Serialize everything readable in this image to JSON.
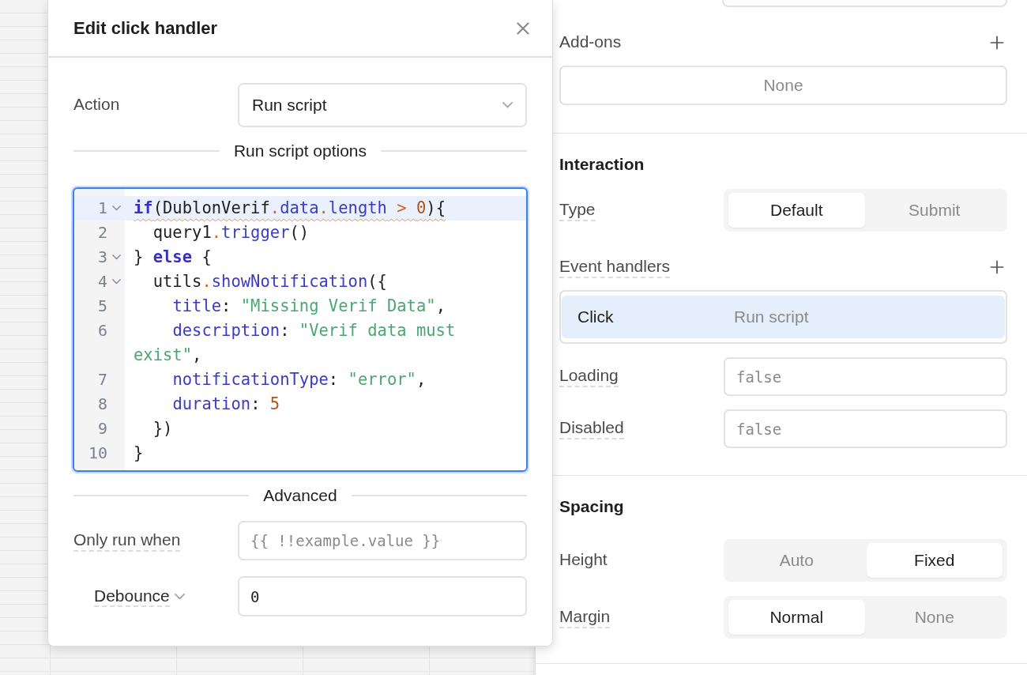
{
  "modal": {
    "title": "Edit click handler",
    "action": {
      "label": "Action",
      "value": "Run script"
    },
    "script_section": "Run script options",
    "code_lines": [
      {
        "number": "1",
        "foldable": true,
        "active": true,
        "warning": true,
        "tokens": [
          {
            "kind": "keyword",
            "text": "if"
          },
          {
            "kind": "plain",
            "text": "(DublonVerif"
          },
          {
            "kind": "operator",
            "text": "."
          },
          {
            "kind": "property",
            "text": "data"
          },
          {
            "kind": "operator",
            "text": "."
          },
          {
            "kind": "property",
            "text": "length"
          },
          {
            "kind": "operator",
            "text": " > "
          },
          {
            "kind": "number",
            "text": "0"
          },
          {
            "kind": "plain",
            "text": "){"
          }
        ]
      },
      {
        "number": "2",
        "foldable": false,
        "active": false,
        "warning": false,
        "tokens": [
          {
            "kind": "plain",
            "text": "  query1"
          },
          {
            "kind": "operator",
            "text": "."
          },
          {
            "kind": "property",
            "text": "trigger"
          },
          {
            "kind": "plain",
            "text": "()"
          }
        ]
      },
      {
        "number": "3",
        "foldable": true,
        "active": false,
        "warning": false,
        "tokens": [
          {
            "kind": "plain",
            "text": "} "
          },
          {
            "kind": "keyword",
            "text": "else"
          },
          {
            "kind": "plain",
            "text": " {"
          }
        ]
      },
      {
        "number": "4",
        "foldable": true,
        "active": false,
        "warning": false,
        "tokens": [
          {
            "kind": "plain",
            "text": "  utils"
          },
          {
            "kind": "operator",
            "text": "."
          },
          {
            "kind": "property",
            "text": "showNotification"
          },
          {
            "kind": "plain",
            "text": "({"
          }
        ]
      },
      {
        "number": "5",
        "foldable": false,
        "active": false,
        "warning": false,
        "tokens": [
          {
            "kind": "property",
            "text": "    title"
          },
          {
            "kind": "plain",
            "text": ": "
          },
          {
            "kind": "string",
            "text": "\"Missing Verif Data\""
          },
          {
            "kind": "plain",
            "text": ","
          }
        ]
      },
      {
        "number": "6",
        "foldable": false,
        "active": false,
        "warning": false,
        "tokens": [
          {
            "kind": "property",
            "text": "    description"
          },
          {
            "kind": "plain",
            "text": ": "
          },
          {
            "kind": "string",
            "text": "\"Verif data must exist\""
          },
          {
            "kind": "plain",
            "text": ","
          }
        ]
      },
      {
        "number": "7",
        "foldable": false,
        "active": false,
        "warning": false,
        "tokens": [
          {
            "kind": "property",
            "text": "    notificationType"
          },
          {
            "kind": "plain",
            "text": ": "
          },
          {
            "kind": "string",
            "text": "\"error\""
          },
          {
            "kind": "plain",
            "text": ","
          }
        ]
      },
      {
        "number": "8",
        "foldable": false,
        "active": false,
        "warning": false,
        "tokens": [
          {
            "kind": "property",
            "text": "    duration"
          },
          {
            "kind": "plain",
            "text": ": "
          },
          {
            "kind": "number",
            "text": "5"
          }
        ]
      },
      {
        "number": "9",
        "foldable": false,
        "active": false,
        "warning": false,
        "tokens": [
          {
            "kind": "plain",
            "text": "  })"
          }
        ]
      },
      {
        "number": "10",
        "foldable": false,
        "active": false,
        "warning": false,
        "tokens": [
          {
            "kind": "plain",
            "text": "}"
          }
        ]
      }
    ],
    "advanced_section": "Advanced",
    "advanced_fields": [
      {
        "label": "Only run when",
        "tooltip": true,
        "has_menu": false,
        "placeholder": "{{ !!example.value }}"
      },
      {
        "label": "Debounce",
        "tooltip": true,
        "has_menu": true,
        "value": "0"
      }
    ]
  },
  "inspector": {
    "addons": {
      "label": "Add-ons",
      "value": "None"
    },
    "interaction": {
      "title": "Interaction",
      "type": {
        "label": "Type",
        "tooltip": true,
        "options": [
          {
            "label": "Default",
            "selected": true
          },
          {
            "label": "Submit",
            "selected": false
          }
        ]
      },
      "event_handlers": {
        "label": "Event handlers",
        "tooltip": true,
        "items": [
          {
            "event": "Click",
            "action": "Run script",
            "selected": true
          }
        ]
      },
      "fields": [
        {
          "label": "Loading",
          "tooltip": true,
          "placeholder": "false"
        },
        {
          "label": "Disabled",
          "tooltip": true,
          "placeholder": "false"
        }
      ]
    },
    "spacing": {
      "title": "Spacing",
      "rows": [
        {
          "label": "Height",
          "tooltip": false,
          "options": [
            {
              "label": "Auto",
              "selected": false
            },
            {
              "label": "Fixed",
              "selected": true
            }
          ]
        },
        {
          "label": "Margin",
          "tooltip": true,
          "options": [
            {
              "label": "Normal",
              "selected": true
            },
            {
              "label": "None",
              "selected": false
            }
          ]
        }
      ]
    }
  }
}
